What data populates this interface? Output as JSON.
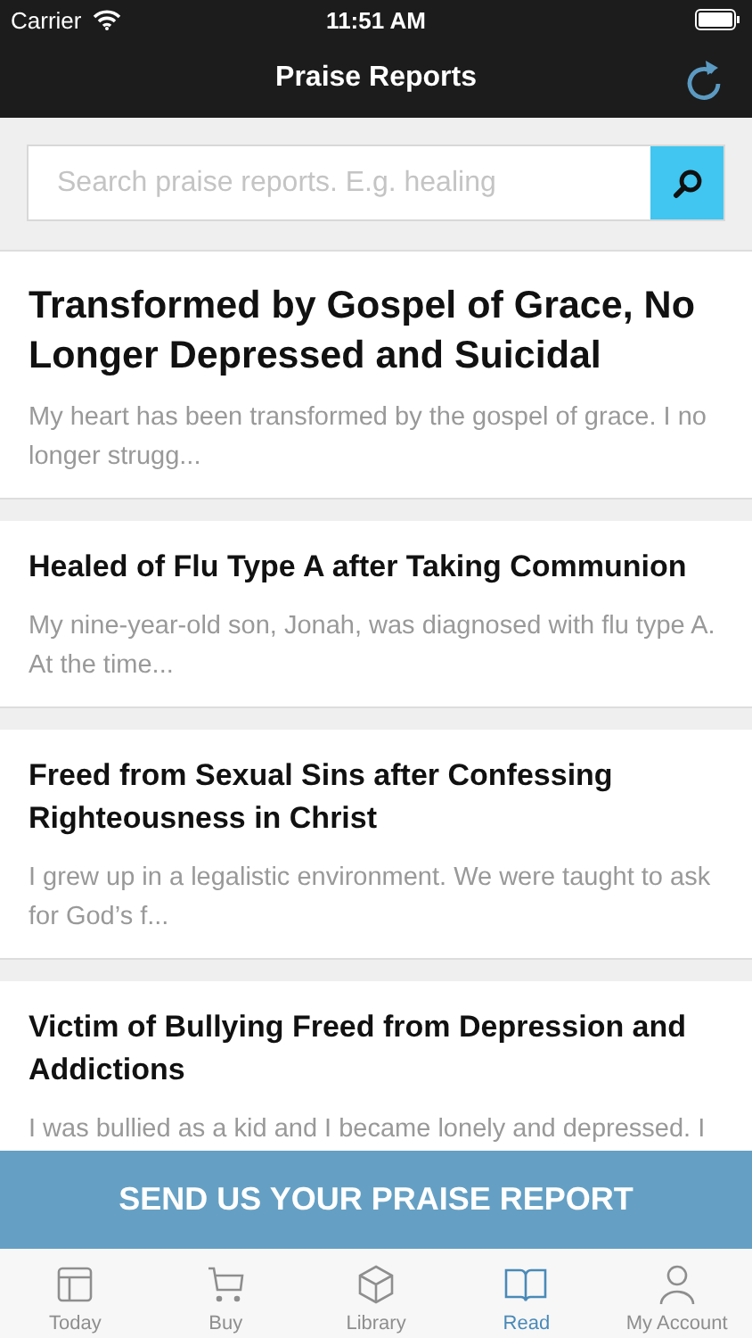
{
  "status_bar": {
    "carrier": "Carrier",
    "time": "11:51 AM"
  },
  "nav": {
    "title": "Praise Reports"
  },
  "search": {
    "placeholder": "Search praise reports. E.g. healing"
  },
  "reports": [
    {
      "kind": "featured",
      "title": "Transformed by Gospel of Grace, No Longer Depressed and Suicidal",
      "excerpt": "My heart has been transformed by the gospel of grace. I no longer strugg..."
    },
    {
      "kind": "normal",
      "title": "Healed of Flu Type A after Taking Communion",
      "excerpt": "My nine-year-old son, Jonah, was diagnosed with flu type A. At the time..."
    },
    {
      "kind": "normal",
      "title": "Freed from Sexual Sins after Confessing Righteousness in Christ",
      "excerpt": "I grew up in a legalistic environment. We were taught to ask for God’s f..."
    },
    {
      "kind": "normal",
      "title": "Victim of Bullying Freed from Depression and Addictions",
      "excerpt": "I was bullied as a kid and I became lonely and depressed. I"
    }
  ],
  "send_button": "SEND US YOUR PRAISE REPORT",
  "tabs": [
    {
      "kind": "today",
      "label": "Today",
      "selected": false
    },
    {
      "kind": "buy",
      "label": "Buy",
      "selected": false
    },
    {
      "kind": "library",
      "label": "Library",
      "selected": false
    },
    {
      "kind": "read",
      "label": "Read",
      "selected": true
    },
    {
      "kind": "account",
      "label": "My Account",
      "selected": false
    }
  ]
}
